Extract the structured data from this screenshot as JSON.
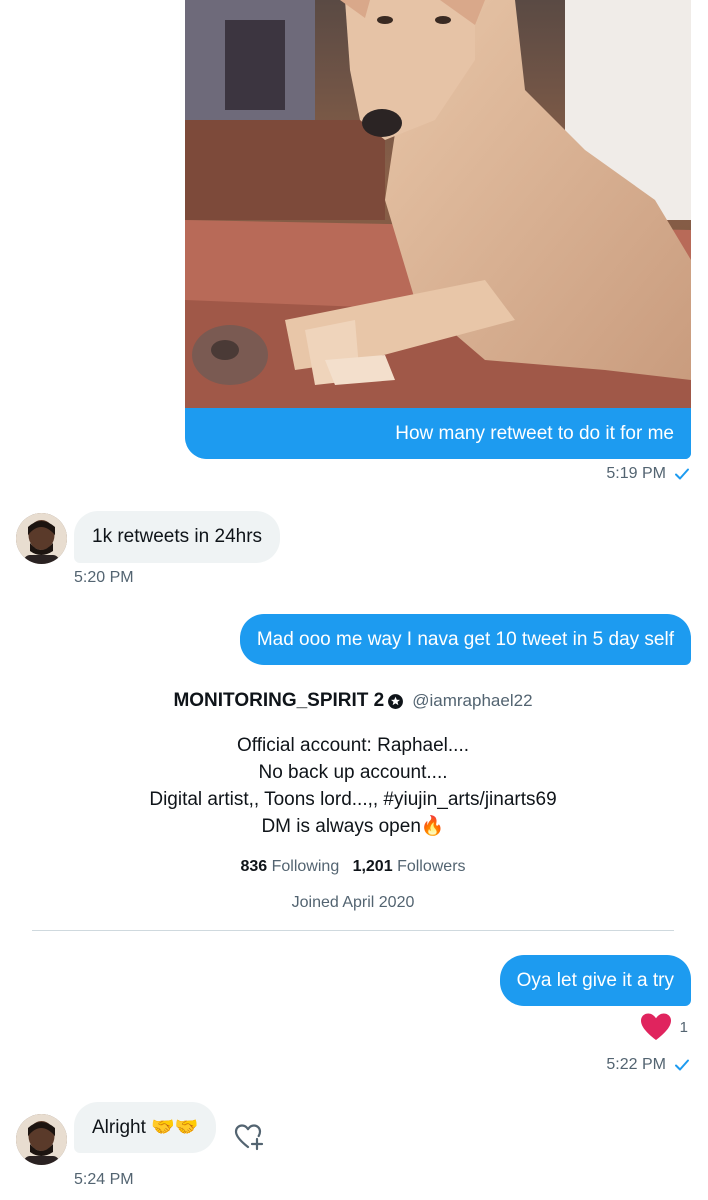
{
  "messages": {
    "media": {
      "caption": "How many retweet to do it for me",
      "time": "5:19 PM"
    },
    "reply1": {
      "text": "1k retweets in 24hrs",
      "time": "5:20 PM"
    },
    "sent2": {
      "text": "Mad ooo me way I nava get 10 tweet in 5 day self"
    },
    "sent3": {
      "text": "Oya let give it a try",
      "reaction_count": "1",
      "time": "5:22 PM"
    },
    "reply2": {
      "text": "Alright 🤝🤝",
      "time": "5:24 PM"
    }
  },
  "profile": {
    "name": "MONITORING_SPIRIT 2",
    "handle": "@iamraphael22",
    "bio": [
      "Official account: Raphael....",
      "No back up account....",
      "Digital artist,, Toons lord...,, #yiujin_arts/jinarts69",
      "DM is always open🔥"
    ],
    "following_count": "836",
    "following_label": "Following",
    "followers_count": "1,201",
    "followers_label": "Followers",
    "joined": "Joined April 2020"
  },
  "colors": {
    "accent": "#1d9bf0",
    "incoming_bubble": "#eff3f4",
    "heart": "#e0245e"
  },
  "icons": {
    "read_receipt": "check-icon",
    "reaction": "heart-icon",
    "add_reaction": "add-reaction-icon",
    "name_badge": "gear-icon"
  }
}
